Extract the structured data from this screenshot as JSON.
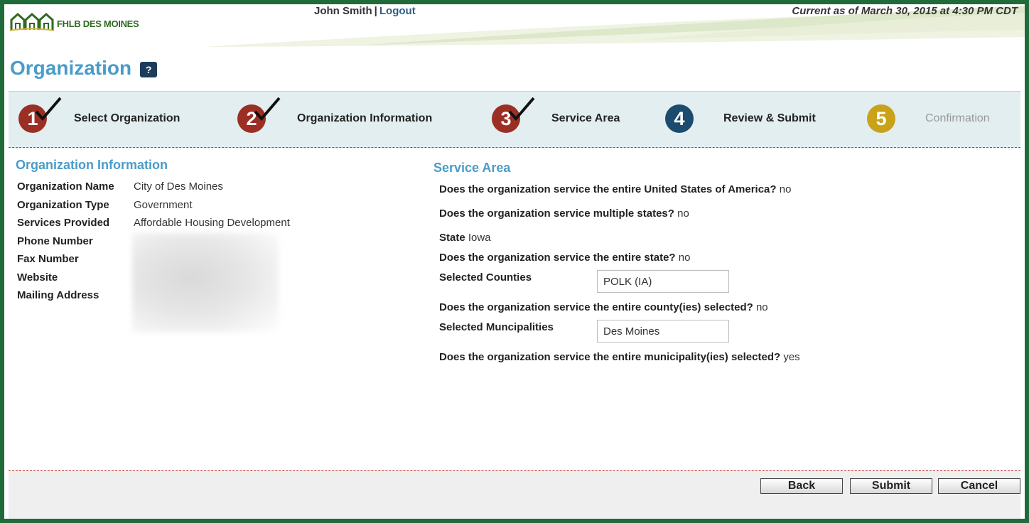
{
  "header": {
    "logo_text": "FHLB DES MOINES",
    "user_name": "John Smith",
    "separator": "|",
    "logout_label": "Logout",
    "current_as_of": "Current as of March 30, 2015 at 4:30 PM CDT"
  },
  "page": {
    "title": "Organization",
    "help_label": "?"
  },
  "steps": [
    {
      "number": "1",
      "label": "Select Organization",
      "status": "done"
    },
    {
      "number": "2",
      "label": "Organization Information",
      "status": "done"
    },
    {
      "number": "3",
      "label": "Service Area",
      "status": "done"
    },
    {
      "number": "4",
      "label": "Review & Submit",
      "status": "current"
    },
    {
      "number": "5",
      "label": "Confirmation",
      "status": "pending"
    }
  ],
  "org_info": {
    "title": "Organization Information",
    "rows": [
      {
        "label": "Organization Name",
        "value": "City of Des Moines"
      },
      {
        "label": "Organization Type",
        "value": "Government"
      },
      {
        "label": "Services Provided",
        "value": "Affordable Housing Development"
      },
      {
        "label": "Phone Number",
        "value": ""
      },
      {
        "label": "Fax Number",
        "value": ""
      },
      {
        "label": "Website",
        "value": ""
      },
      {
        "label": "Mailing Address",
        "value": ""
      }
    ]
  },
  "service_area": {
    "title": "Service Area",
    "q_entire_usa": "Does the organization service the entire United States of America?",
    "a_entire_usa": "no",
    "q_multiple_states": "Does the organization service multiple states?",
    "a_multiple_states": "no",
    "state_label": "State",
    "state_value": "Iowa",
    "q_entire_state": "Does the organization service the entire state?",
    "a_entire_state": "no",
    "counties_label": "Selected Counties",
    "counties_value": "POLK (IA)",
    "q_entire_county": "Does the organization service the entire county(ies) selected?",
    "a_entire_county": "no",
    "municipalities_label": "Selected Muncipalities",
    "municipalities_value": "Des Moines",
    "q_entire_municipality": "Does the organization service the entire municipality(ies) selected?",
    "a_entire_municipality": "yes"
  },
  "buttons": {
    "back": "Back",
    "submit": "Submit",
    "cancel": "Cancel"
  },
  "colors": {
    "frame": "#1f6b3a",
    "title_blue": "#4a9cc9",
    "step_done": "#9b2f24",
    "step_current": "#1b4b6e",
    "step_pending": "#c9a21a"
  },
  "icons": {
    "logo": "houses-logo-icon",
    "help": "help-icon",
    "check": "checkmark-icon"
  }
}
